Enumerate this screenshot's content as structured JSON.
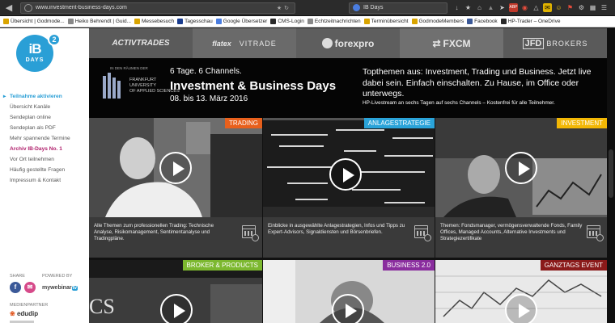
{
  "browser": {
    "url": "www.investment-business-days.com",
    "search_query": "IB Days",
    "bookmarks": [
      {
        "label": "Übersicht | Godmode...",
        "color": "#d9a400"
      },
      {
        "label": "Heiko Behrendt | Guid...",
        "color": "#888888"
      },
      {
        "label": "Messebesuch",
        "color": "#d9a400"
      },
      {
        "label": "Tagesschau",
        "color": "#1a3d8f"
      },
      {
        "label": "Google Übersetzer",
        "color": "#4a7de0"
      },
      {
        "label": "CMS-Login",
        "color": "#2a2a2a"
      },
      {
        "label": "Echtzeitnachrichten",
        "color": "#888888"
      },
      {
        "label": "Terminübersicht",
        "color": "#d9a400"
      },
      {
        "label": "GodmodeMembers",
        "color": "#d9a400"
      },
      {
        "label": "Facebook",
        "color": "#3b5998"
      },
      {
        "label": "HP-Trader – OneDrive",
        "color": "#2a2a2a"
      }
    ]
  },
  "logo": {
    "main": "iB",
    "sup": "2",
    "sub": "DAYS"
  },
  "sidebar": {
    "menu": [
      "Teilnahme aktivieren",
      "Übersicht Kanäle",
      "Sendeplan online",
      "Sendeplan als PDF",
      "Mehr spannende Termine",
      "Archiv IB-Days No. 1",
      "Vor Ort teilnehmen",
      "Häufig gestellte Fragen",
      "Impressum & Kontakt"
    ],
    "share_label": "SHARE",
    "powered_label": "POWERED BY",
    "powered_brand": "mywebinar",
    "powered_tv": "tv",
    "partner_label": "MEDIENPARTNER",
    "partner_name": "edudip"
  },
  "sponsors": {
    "s1": "ACTIVTRADES",
    "s2a": "flatex",
    "s2b": "VITRADE",
    "s3": "forexpro",
    "s4": "FXCM",
    "s5a": "JFD",
    "s5b": "BROKERS"
  },
  "banner": {
    "univ_top": "IN DEN RÄUMEN DER",
    "univ_lines": [
      "FRANKFURT",
      "UNIVERSITY",
      "OF APPLIED SCIENCES"
    ],
    "line1": "6 Tage. 6 Channels.",
    "title": "Investment & Business Days",
    "date": "08. bis 13. März 2016",
    "right": "Topthemen aus: Investment, Trading und Business. Jetzt live dabei sein. Einfach einschalten. Zu Hause, im Office oder unterwegs.",
    "sub": "HP-Livestream an sechs Tagen auf sechs Channels – Kostenfrei für alle Teilnehmer."
  },
  "tiles": [
    {
      "tag": "TRADING",
      "color": "#e8601c",
      "desc": "Alle Themen zum professionellen Trading: Technische Analyse, Risikomanagement, Sentimentanalyse und Tradingpläne."
    },
    {
      "tag": "ANLAGESTRATEGIE",
      "color": "#2aa3d9",
      "desc": "Einblicke in ausgewählte Anlagestrategien, Infos und Tipps zu Expert-Advisors, Signaldiensten und Börsenbriefen."
    },
    {
      "tag": "INVESTMENT",
      "color": "#f2b705",
      "desc": "Themen: Fondsmanager, vermögensverwaltende Fonds, Family Offices, Managed Accounts, Alternative Investments und Strategiezertifikate"
    },
    {
      "tag": "BROKER & PRODUCTS",
      "color": "#7cb82f"
    },
    {
      "tag": "BUSINESS 2.0",
      "color": "#8a2d9e"
    },
    {
      "tag": "GANZTAGS EVENT",
      "color": "#8a1a1a"
    }
  ]
}
